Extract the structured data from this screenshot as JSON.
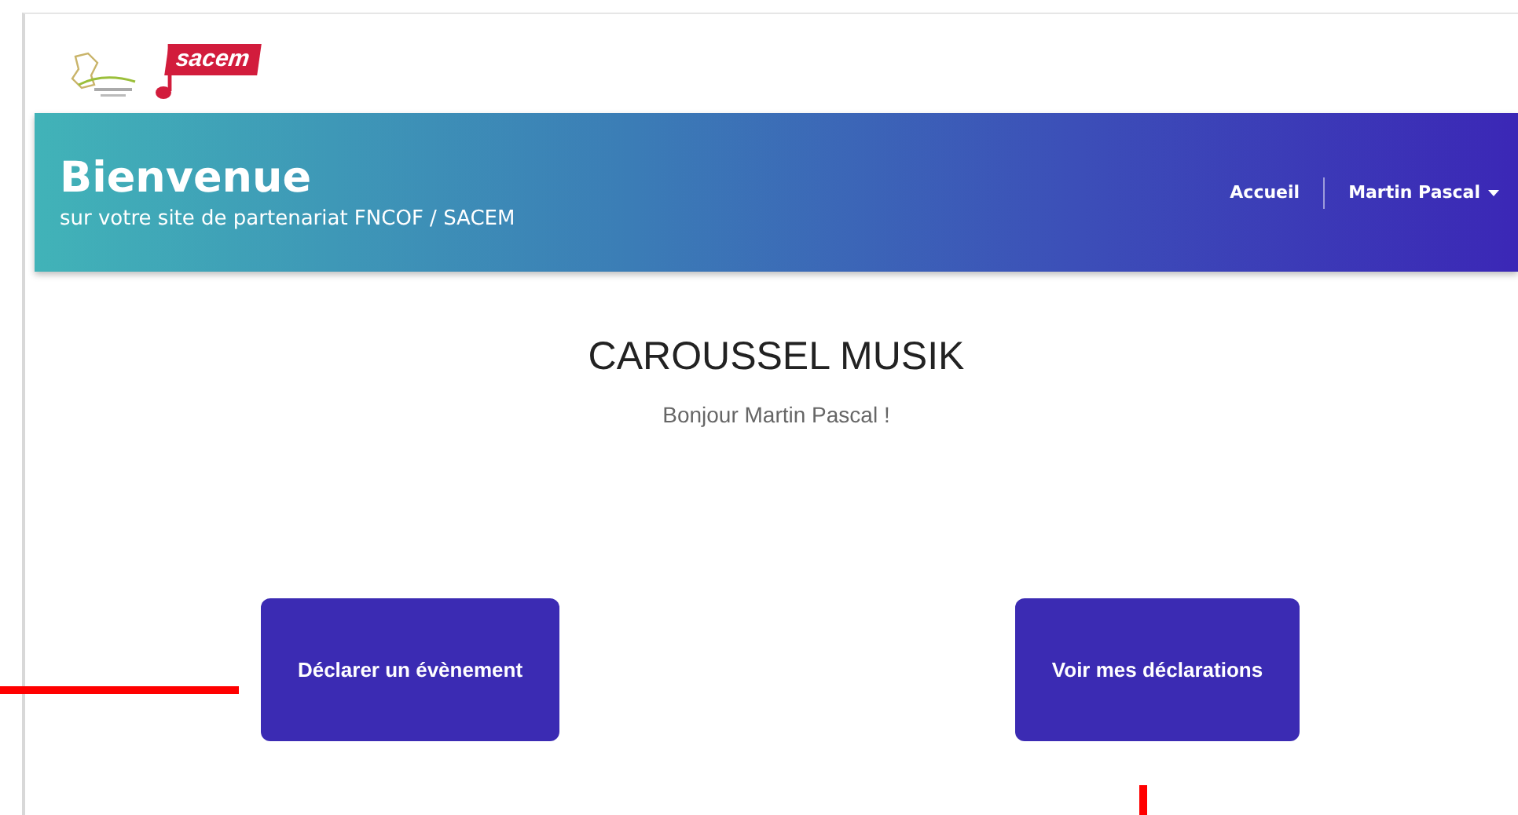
{
  "header": {
    "logo_text": "sacem"
  },
  "banner": {
    "title": "Bienvenue",
    "subtitle": "sur votre site de partenariat FNCOF / SACEM",
    "nav": [
      {
        "label": "Accueil",
        "kind": "link"
      },
      {
        "label": "Martin Pascal",
        "kind": "dropdown"
      }
    ]
  },
  "main": {
    "title": "CAROUSSEL MUSIK",
    "greeting": "Bonjour Martin Pascal !"
  },
  "buttons": [
    {
      "label": "Déclarer un évènement"
    },
    {
      "label": "Voir mes déclarations"
    }
  ],
  "annotations": [
    {
      "kind": "horizontal"
    },
    {
      "kind": "vertical"
    }
  ]
}
